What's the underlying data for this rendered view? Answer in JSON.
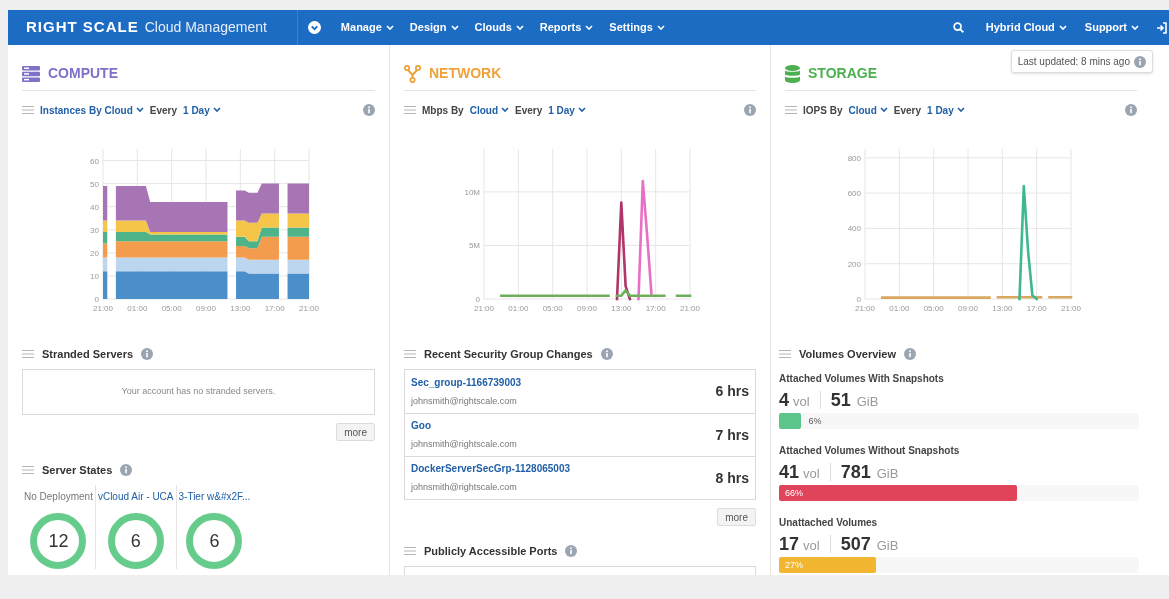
{
  "nav": {
    "logo": "RIGHT SCALE",
    "product": "Cloud Management",
    "menus": [
      "Manage",
      "Design",
      "Clouds",
      "Reports",
      "Settings"
    ],
    "right_menus": [
      "Hybrid Cloud",
      "Support"
    ]
  },
  "last_updated": "Last updated: 8 mins ago",
  "columns": [
    {
      "kind": "compute",
      "title": "COMPUTE",
      "widgets": [
        {
          "kind": "chart",
          "header": [
            {
              "text": "Instances By Cloud",
              "dropdown": true
            },
            {
              "text": "Every",
              "dropdown": false
            },
            {
              "text": "1 Day",
              "dropdown": true
            }
          ],
          "chart_data": {
            "type": "area",
            "stacked": true,
            "grid": true,
            "ylim": [
              0,
              65
            ],
            "categories": [
              "21:00",
              null,
              null,
              null,
              null,
              null,
              null,
              null,
              "01:00",
              null,
              null,
              null,
              null,
              null,
              null,
              null,
              "05:00",
              null,
              null,
              null,
              null,
              null,
              null,
              null,
              "09:00",
              null,
              null,
              null,
              null,
              null,
              null,
              null,
              "13:00",
              null,
              null,
              null,
              null,
              null,
              null,
              null,
              "17:00",
              null,
              null,
              null,
              null,
              null,
              null,
              null,
              "21:00"
            ],
            "yticks": [
              0,
              10,
              20,
              30,
              40,
              50,
              60
            ],
            "series": [
              {
                "color": "#4a8fc9",
                "values": [
                  12,
                  12,
                  null,
                  12,
                  12,
                  12,
                  12,
                  12,
                  12,
                  12,
                  12,
                  12,
                  12,
                  12,
                  12,
                  12,
                  12,
                  12,
                  12,
                  12,
                  12,
                  12,
                  12,
                  12,
                  12,
                  12,
                  12,
                  12,
                  12,
                  12,
                  null,
                  12,
                  12,
                  12,
                  11,
                  11,
                  11,
                  11,
                  11,
                  11,
                  11,
                  11,
                  null,
                  11,
                  11,
                  11,
                  11,
                  11,
                  11
                ]
              },
              {
                "color": "#bcd6f0",
                "values": [
                  6,
                  6,
                  null,
                  6,
                  6,
                  6,
                  6,
                  6,
                  6,
                  6,
                  6,
                  6,
                  6,
                  6,
                  6,
                  6,
                  6,
                  6,
                  6,
                  6,
                  6,
                  6,
                  6,
                  6,
                  6,
                  6,
                  6,
                  6,
                  6,
                  6,
                  null,
                  6,
                  6,
                  6,
                  6,
                  6,
                  6,
                  6,
                  6,
                  6,
                  6,
                  6,
                  null,
                  6,
                  6,
                  6,
                  6,
                  6,
                  6
                ]
              },
              {
                "color": "#f39c4e",
                "values": [
                  6,
                  6,
                  null,
                  7,
                  7,
                  7,
                  7,
                  7,
                  7,
                  7,
                  7,
                  7,
                  7,
                  7,
                  7,
                  7,
                  7,
                  7,
                  7,
                  7,
                  7,
                  7,
                  7,
                  7,
                  7,
                  7,
                  7,
                  7,
                  7,
                  7,
                  null,
                  5,
                  5,
                  5,
                  5,
                  5,
                  5,
                  10,
                  10,
                  10,
                  10,
                  10,
                  null,
                  10,
                  10,
                  10,
                  10,
                  10,
                  10
                ]
              },
              {
                "color": "#4fb38a",
                "values": [
                  5,
                  5,
                  null,
                  4,
                  4,
                  4,
                  4,
                  4,
                  4,
                  4,
                  4,
                  3,
                  3,
                  3,
                  3,
                  3,
                  3,
                  3,
                  3,
                  3,
                  3,
                  3,
                  3,
                  3,
                  3,
                  3,
                  3,
                  3,
                  3,
                  3,
                  null,
                  4,
                  4,
                  4,
                  3,
                  3,
                  3,
                  4,
                  4,
                  4,
                  4,
                  4,
                  null,
                  4,
                  4,
                  4,
                  4,
                  4,
                  4
                ]
              },
              {
                "color": "#f5c54a",
                "values": [
                  5,
                  5,
                  null,
                  5,
                  5,
                  5,
                  5,
                  5,
                  5,
                  5,
                  5,
                  1,
                  1,
                  1,
                  1,
                  1,
                  1,
                  1,
                  1,
                  1,
                  1,
                  1,
                  1,
                  1,
                  1,
                  1,
                  1,
                  1,
                  1,
                  1,
                  null,
                  7,
                  7,
                  7,
                  8,
                  8,
                  8,
                  6,
                  6,
                  6,
                  6,
                  6,
                  null,
                  6,
                  6,
                  6,
                  6,
                  6,
                  6
                ]
              },
              {
                "color": "#a875b4",
                "values": [
                  15,
                  15,
                  null,
                  15,
                  15,
                  15,
                  15,
                  15,
                  15,
                  15,
                  15,
                  13,
                  13,
                  13,
                  13,
                  13,
                  13,
                  13,
                  13,
                  13,
                  13,
                  13,
                  13,
                  13,
                  13,
                  13,
                  13,
                  13,
                  13,
                  13,
                  null,
                  13,
                  13,
                  13,
                  13,
                  13,
                  13,
                  13,
                  13,
                  13,
                  13,
                  13,
                  null,
                  13,
                  13,
                  13,
                  13,
                  13,
                  13
                ]
              }
            ]
          }
        },
        {
          "kind": "message",
          "title": "Stranded Servers",
          "message": "Your account has no stranded servers.",
          "button": "more"
        },
        {
          "kind": "server_states",
          "title": "Server States",
          "deployments": [
            {
              "name": "No Deployment",
              "link": false,
              "count": "12"
            },
            {
              "name": "vCloud Air - UCA",
              "link": true,
              "count": "6"
            },
            {
              "name": "3-Tier w&#x2F...",
              "link": true,
              "count": "6"
            }
          ]
        }
      ]
    },
    {
      "kind": "network",
      "title": "NETWORK",
      "widgets": [
        {
          "kind": "chart",
          "header": [
            {
              "text": "Mbps By",
              "dropdown": false
            },
            {
              "text": "Cloud",
              "dropdown": true
            },
            {
              "text": "Every",
              "dropdown": false
            },
            {
              "text": "1 Day",
              "dropdown": true
            }
          ],
          "chart_data": {
            "type": "line",
            "grid": true,
            "ylim": [
              0,
              14
            ],
            "categories": [
              "21:00",
              null,
              null,
              null,
              null,
              null,
              null,
              null,
              "01:00",
              null,
              null,
              null,
              null,
              null,
              null,
              null,
              "05:00",
              null,
              null,
              null,
              null,
              null,
              null,
              null,
              "09:00",
              null,
              null,
              null,
              null,
              null,
              null,
              null,
              "13:00",
              null,
              null,
              null,
              null,
              null,
              null,
              null,
              "17:00",
              null,
              null,
              null,
              null,
              null,
              null,
              null,
              "21:00"
            ],
            "yticks": [
              {
                "value": 0,
                "label": "0"
              },
              {
                "value": 5,
                "label": "5M"
              },
              {
                "value": 10,
                "label": "10M"
              }
            ],
            "series": [
              {
                "color": "#b0356a",
                "values": [
                  null,
                  null,
                  null,
                  null,
                  null,
                  null,
                  null,
                  null,
                  null,
                  null,
                  null,
                  null,
                  null,
                  null,
                  null,
                  null,
                  null,
                  null,
                  null,
                  null,
                  null,
                  null,
                  null,
                  null,
                  null,
                  null,
                  null,
                  null,
                  null,
                  null,
                  null,
                  0,
                  9,
                  1.2,
                  0,
                  null,
                  null,
                  null,
                  null,
                  null,
                  null,
                  null,
                  null,
                  null,
                  null,
                  null,
                  null,
                  null,
                  null
                ]
              },
              {
                "color": "#e86fc4",
                "values": [
                  null,
                  null,
                  null,
                  null,
                  null,
                  null,
                  null,
                  null,
                  null,
                  null,
                  null,
                  null,
                  null,
                  null,
                  null,
                  null,
                  null,
                  null,
                  null,
                  null,
                  null,
                  null,
                  null,
                  null,
                  null,
                  null,
                  null,
                  null,
                  null,
                  null,
                  null,
                  null,
                  null,
                  null,
                  null,
                  null,
                  0,
                  11,
                  6,
                  0.5,
                  null,
                  null,
                  null,
                  null,
                  null,
                  null,
                  null,
                  null,
                  null
                ]
              },
              {
                "color": "#6fae5a",
                "values": [
                  null,
                  null,
                  null,
                  null,
                  0.3,
                  0.3,
                  0.3,
                  0.3,
                  0.3,
                  0.3,
                  0.3,
                  0.3,
                  0.3,
                  0.3,
                  0.3,
                  0.3,
                  0.3,
                  0.3,
                  0.3,
                  0.3,
                  0.3,
                  0.3,
                  0.3,
                  0.3,
                  0.3,
                  0.3,
                  0.3,
                  0.3,
                  0.3,
                  0.3,
                  null,
                  0.3,
                  0.3,
                  0.8,
                  0.3,
                  0.3,
                  0.3,
                  0.3,
                  0.3,
                  0.3,
                  0.3,
                  0.3,
                  0.3,
                  null,
                  null,
                  0.3,
                  0.3,
                  0.3,
                  0.3
                ]
              }
            ]
          }
        },
        {
          "kind": "changes",
          "title": "Recent Security Group Changes",
          "rows": [
            {
              "name": "Sec_group-1166739003",
              "user": "johnsmith@rightscale.com",
              "age": "6 hrs"
            },
            {
              "name": "Goo",
              "user": "johnsmith@rightscale.com",
              "age": "7 hrs"
            },
            {
              "name": "DockerServerSecGrp-1128065003",
              "user": "johnsmith@rightscale.com",
              "age": "8 hrs"
            }
          ],
          "button": "more"
        },
        {
          "kind": "ports",
          "title": "Publicly Accessible Ports"
        }
      ]
    },
    {
      "kind": "storage",
      "title": "STORAGE",
      "widgets": [
        {
          "kind": "chart",
          "header": [
            {
              "text": "IOPS By",
              "dropdown": false
            },
            {
              "text": "Cloud",
              "dropdown": true
            },
            {
              "text": "Every",
              "dropdown": false
            },
            {
              "text": "1 Day",
              "dropdown": true
            }
          ],
          "chart_data": {
            "type": "line",
            "grid": true,
            "ylim": [
              0,
              850
            ],
            "categories": [
              "21:00",
              null,
              null,
              null,
              null,
              null,
              null,
              null,
              "01:00",
              null,
              null,
              null,
              null,
              null,
              null,
              null,
              "05:00",
              null,
              null,
              null,
              null,
              null,
              null,
              null,
              "09:00",
              null,
              null,
              null,
              null,
              null,
              null,
              null,
              "13:00",
              null,
              null,
              null,
              null,
              null,
              null,
              null,
              "17:00",
              null,
              null,
              null,
              null,
              null,
              null,
              null,
              "21:00"
            ],
            "yticks": [
              0,
              200,
              400,
              600,
              800
            ],
            "series": [
              {
                "color": "#d9a860",
                "values": [
                  null,
                  null,
                  null,
                  null,
                  8,
                  8,
                  8,
                  8,
                  8,
                  8,
                  8,
                  8,
                  8,
                  8,
                  8,
                  8,
                  8,
                  8,
                  8,
                  8,
                  8,
                  8,
                  8,
                  8,
                  8,
                  8,
                  8,
                  8,
                  8,
                  8,
                  null,
                  10,
                  10,
                  10,
                  10,
                  10,
                  10,
                  10,
                  10,
                  10,
                  10,
                  10,
                  null,
                  10,
                  10,
                  10,
                  10,
                  10,
                  10
                ]
              },
              {
                "color": "#3fb88a",
                "values": [
                  null,
                  null,
                  null,
                  null,
                  null,
                  null,
                  null,
                  null,
                  null,
                  null,
                  null,
                  null,
                  null,
                  null,
                  null,
                  null,
                  null,
                  null,
                  null,
                  null,
                  null,
                  null,
                  null,
                  null,
                  null,
                  null,
                  null,
                  null,
                  null,
                  null,
                  null,
                  null,
                  null,
                  null,
                  null,
                  null,
                  0,
                  640,
                  270,
                  20,
                  0,
                  null,
                  null,
                  null,
                  null,
                  null,
                  null,
                  null,
                  null
                ]
              }
            ]
          }
        },
        {
          "kind": "volumes",
          "title": "Volumes Overview",
          "groups": [
            {
              "title": "Attached Volumes With Snapshots",
              "count": "4",
              "count_unit": "vol",
              "size": "51",
              "size_unit": "GiB",
              "level": 0.06,
              "percent": "6%",
              "color": "#5cc68a"
            },
            {
              "title": "Attached Volumes Without Snapshots",
              "count": "41",
              "count_unit": "vol",
              "size": "781",
              "size_unit": "GiB",
              "level": 0.66,
              "percent": "66%",
              "color": "#e0445a"
            },
            {
              "title": "Unattached Volumes",
              "count": "17",
              "count_unit": "vol",
              "size": "507",
              "size_unit": "GiB",
              "level": 0.27,
              "percent": "27%",
              "color": "#f2b630"
            }
          ]
        }
      ]
    }
  ]
}
